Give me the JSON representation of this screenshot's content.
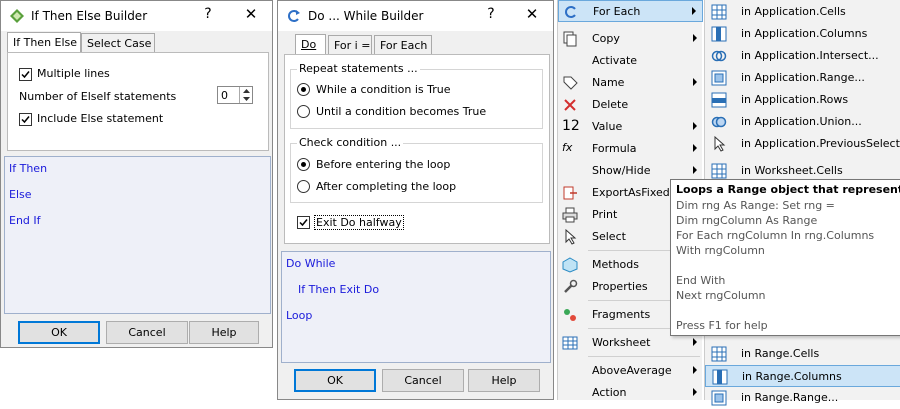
{
  "ifbuilder": {
    "title": "If Then Else Builder",
    "help": "?",
    "close": "✕",
    "tabs": [
      "If Then Else",
      "Select Case"
    ],
    "multiple_lines": "Multiple lines",
    "num_elseif_label": "Number of ElseIf statements",
    "num_elseif_value": "0",
    "include_else": "Include Else statement",
    "code": [
      "If  Then",
      "Else",
      "End If"
    ],
    "ok": "OK",
    "cancel": "Cancel",
    "helpbtn": "Help"
  },
  "dobuilder": {
    "title": "Do ... While Builder",
    "help": "?",
    "close": "✕",
    "tabs": [
      "Do",
      "For i =",
      "For Each"
    ],
    "repeat_label": "Repeat statements ...",
    "while_true": "While a condition is True",
    "until_true": "Until a condition becomes True",
    "check_label": "Check condition ...",
    "before": "Before entering the loop",
    "after": "After completing the loop",
    "exit_do": "Exit Do halfway",
    "code": [
      "Do While",
      "If  Then Exit Do",
      "Loop"
    ],
    "ok": "OK",
    "cancel": "Cancel",
    "helpbtn": "Help"
  },
  "menu": {
    "items": [
      "For Each",
      "Copy",
      "Activate",
      "Name",
      "Delete",
      "Value",
      "Formula",
      "Show/Hide",
      "ExportAsFixedF",
      "Print",
      "Select",
      "Methods",
      "Properties",
      "Fragments",
      "Worksheet",
      "AboveAverage",
      "Action"
    ]
  },
  "submenu": {
    "items": [
      "in Application.Cells",
      "in Application.Columns",
      "in Application.Intersect...",
      "in Application.Range...",
      "in Application.Rows",
      "in Application.Union...",
      "in Application.PreviousSelectio",
      "in Worksheet.Cells",
      "in Range.Cells",
      "in Range.Columns",
      "in Range.Range..."
    ]
  },
  "tooltip": {
    "title": "Loops a Range object that represents the",
    "lines": [
      "Dim rng As Range: Set rng =",
      "Dim rngColumn As Range",
      "For Each rngColumn In rng.Columns",
      "                With rngColumn",
      "",
      "                End With",
      "Next rngColumn",
      "",
      "Press F1 for help"
    ]
  },
  "colors": {
    "accent": "#0078d7",
    "highlight": "#cce4f7",
    "code_text": "#1a1adb"
  }
}
